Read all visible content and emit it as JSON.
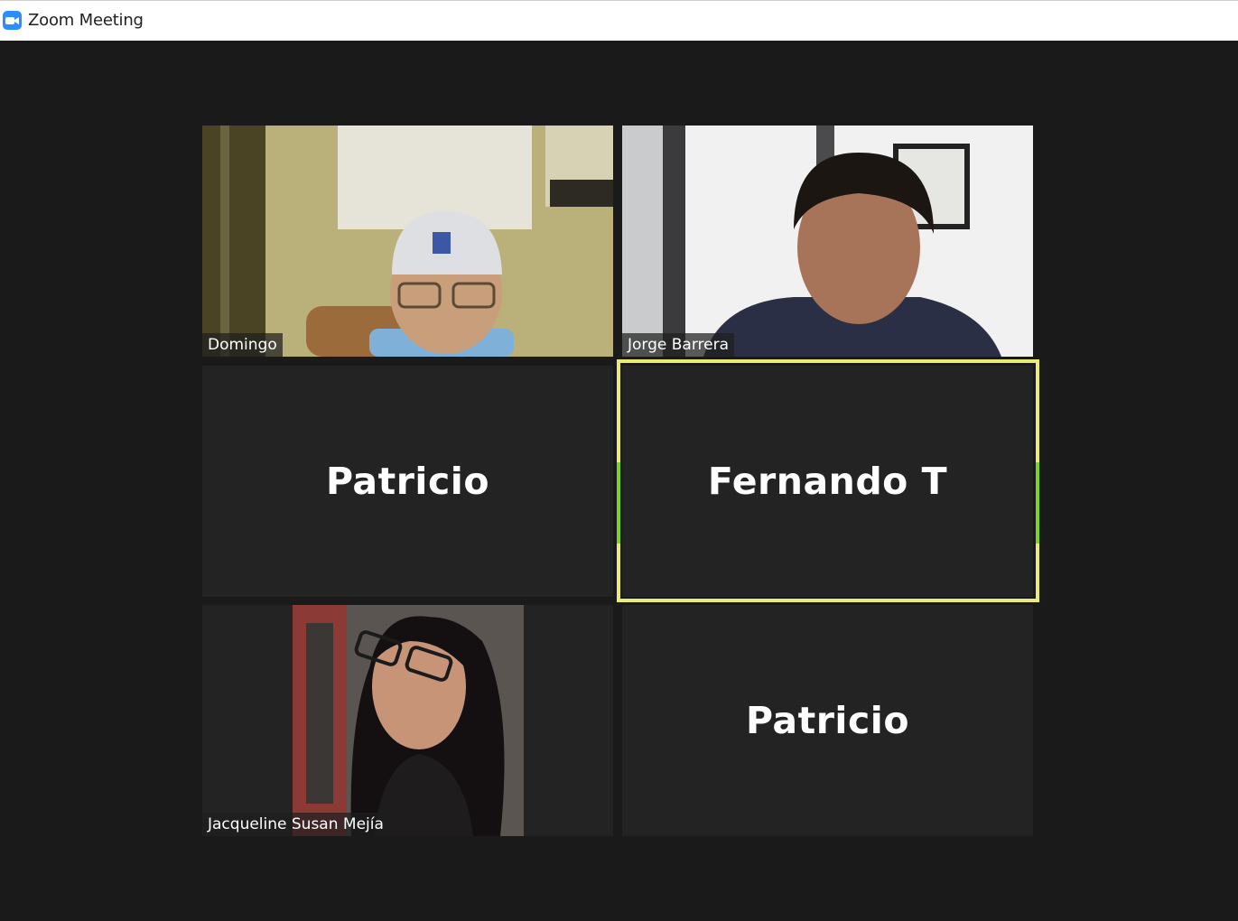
{
  "window": {
    "title": "Zoom Meeting",
    "app_icon": "zoom-camera-icon",
    "brand_color": "#2d8cff"
  },
  "gallery": {
    "background": "#1a1a1a",
    "active_speaker_border": "#e9ea7a",
    "participants": [
      {
        "name": "Domingo",
        "video_on": true
      },
      {
        "name": "Jorge Barrera",
        "video_on": true
      },
      {
        "name": "Patricio",
        "video_on": false
      },
      {
        "name": "Fernando T",
        "video_on": false,
        "active_speaker": true
      },
      {
        "name": "Jacqueline Susan Mejía",
        "video_on": true
      },
      {
        "name": "Patricio",
        "video_on": false
      }
    ]
  }
}
